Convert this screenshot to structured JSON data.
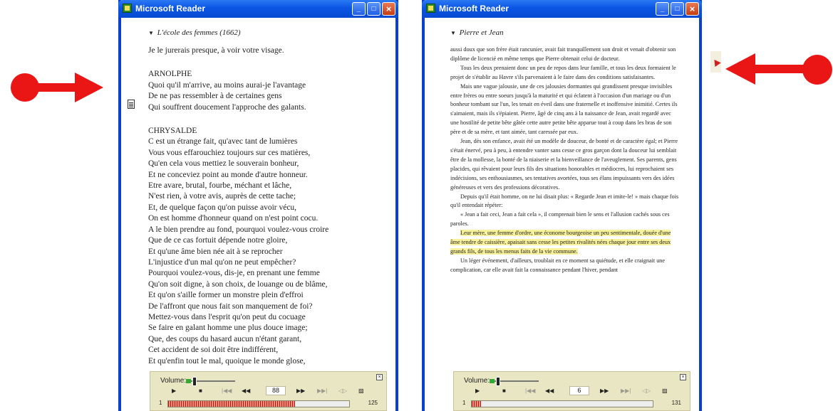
{
  "left_window": {
    "title": "Microsoft Reader",
    "chapter_title": "L'école des femmes (1662)",
    "chapter_arrow": "▼",
    "intro_line": "Je le jurerais presque, à voir votre visage.",
    "speaker1": "ARNOLPHE",
    "speaker1_lines": [
      "Quoi qu'il m'arrive, au moins aurai-je l'avantage",
      "De ne pas ressembler à de certaines gens",
      "Qui souffrent doucement l'approche des galants."
    ],
    "speaker2": "CHRYSALDE",
    "speaker2_lines": [
      "C est un étrange fait, qu'avec tant de lumières",
      "Vous vous effarouchiez toujours sur ces matières,",
      "Qu'en cela vous mettiez le souverain bonheur,",
      "Et ne conceviez point au monde d'autre honneur.",
      "Etre avare, brutal, fourbe, méchant et lâche,",
      "N'est rien, à votre avis, auprès de cette tache;",
      "Et, de quelque façon qu'on puisse avoir vécu,",
      "On est homme d'honneur quand on n'est point cocu.",
      "A le bien prendre au fond, pourquoi voulez-vous croire",
      "Que de ce cas fortuit dépende notre gloire,",
      "Et qu'une âme bien née ait à se reprocher",
      "L'injustice d'un mal qu'on ne peut empêcher?",
      "Pourquoi voulez-vous, dis-je, en prenant une femme",
      "Qu'on soit digne, à son choix, de louange ou de blâme,",
      "Et qu'on s'aille former un monstre plein d'effroi",
      "De l'affront que nous fait son manquement de foi?",
      "Mettez-vous dans l'esprit qu'on peut du cocuage",
      "Se faire en galant homme une plus douce image;",
      "Que, des coups du hasard aucun n'étant garant,",
      "Cet accident de soi doit être indifférent,",
      "Et qu'enfin tout le mal, quoique le monde glose,"
    ],
    "player": {
      "volume_label": "Volume:",
      "page_value": "88",
      "progress_start": "1",
      "progress_end": "125",
      "progress_fraction": 0.7,
      "close_glyph": "×"
    }
  },
  "right_window": {
    "title": "Microsoft Reader",
    "chapter_title": "Pierre et Jean",
    "chapter_arrow": "▼",
    "paragraphs": [
      "aussi doux que son frère était rancunier, avait fait tranquillement son droit et venait d'obtenir son diplôme de licencié en même temps que Pierre obtenait celui de docteur.",
      "Tous les deux prenaient donc un peu de repos dans leur famille, et tous les deux formaient le projet de s'établir au Havre s'ils parvenaient à le faire dans des conditions satisfaisantes.",
      "Mais une vague jalousie, une de ces jalousies dormantes qui grandissent presque invisibles entre frères ou entre soeurs jusqu'à la maturité et qui éclatent à l'occasion d'un mariage ou d'un bonheur tombant sur l'un, les tenait en éveil dans une fraternelle et inoffensive inimitié. Certes ils s'aimaient, mais ils s'épiaient. Pierre, âgé de cinq ans à la naissance de Jean, avait regardé avec une hostilité de petite bête gâtée cette autre petite bête apparue tout à coup dans les bras de son père et de sa mère, et tant aimée, tant caressée par eux.",
      "Jean, dès son enfance, avait été un modèle de douceur, de bonté et de caractère égal; et Pierre s'était énervé, peu à peu, à entendre vanter sans cesse ce gros garçon dont la douceur lui semblait être de la mollesse, la bonté de la niaiserie et la bienveillance de l'aveuglement. Ses parents, gens placides, qui rêvaient pour leurs fils des situations honorables et médiocres, lui reprochaient ses indécisions, ses enthousiasmes, ses tentatives avortées, tous ses élans impuissants vers des idées généreuses et vers des professions décoratives.",
      "Depuis qu'il était homme, on ne lui disait plus: « Regarde Jean et imite-le! » mais chaque fois qu'il entendait répéter:",
      "« Jean a fait ceci, Jean a fait cela », il comprenait bien le sens et l'allusion cachés sous ces paroles."
    ],
    "highlighted_paragraph": "Leur mère, une femme d'ordre, une économe bourgeoise un peu sentimentale, douée d'une âme tendre de caissière, apaisait sans cesse les petites rivalités nées chaque jour entre ses deux grands fils, de tous les menus faits de la vie commune.",
    "last_paragraph": "Un léger événement, d'ailleurs, troublait en ce moment sa quiétude, et elle craignait une complication, car elle avait fait la connaissance pendant l'hiver, pendant",
    "player": {
      "volume_label": "Volume:",
      "page_value": "6",
      "progress_start": "1",
      "progress_end": "131",
      "progress_fraction": 0.05,
      "close_glyph": "×"
    }
  },
  "window_buttons": {
    "minimize": "_",
    "maximize": "□",
    "close": "×"
  },
  "player_controls": {
    "play": "▶",
    "stop": "■",
    "first": "|◀◀",
    "prev": "◀◀",
    "next": "▶▶",
    "last": "▶▶|",
    "loop": "◁▷",
    "bookmark": "▨"
  },
  "icons": {
    "annotation": "document-icon",
    "bookmark": "bookmark-icon"
  },
  "colors": {
    "titlebar": "#0a55e4",
    "highlight": "#f9f29a",
    "arrow": "#ea1515",
    "player_bg": "#e9e7c3",
    "progress": "#b01d12"
  }
}
